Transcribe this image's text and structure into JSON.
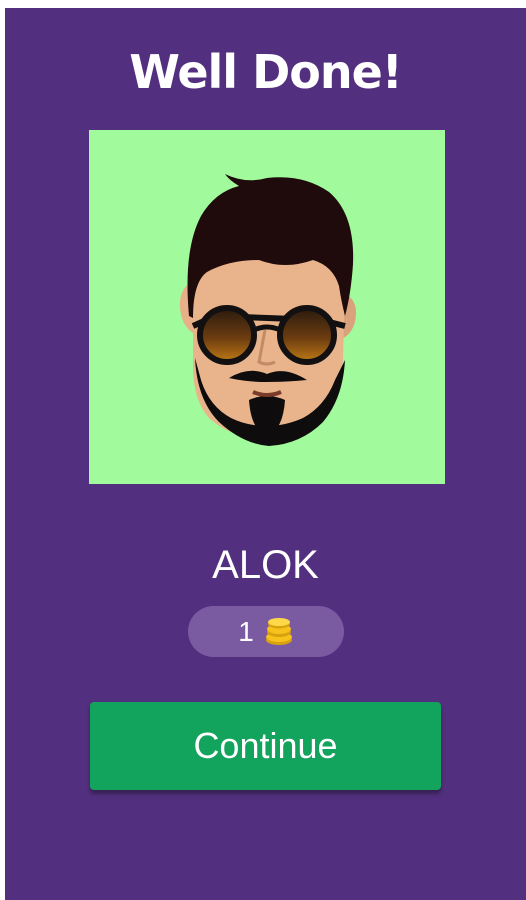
{
  "dialog": {
    "title": "Well Done!",
    "answer": "ALOK",
    "reward": {
      "count": "1",
      "icon": "coins-icon"
    },
    "continue_label": "Continue"
  },
  "colors": {
    "panel_background": "#53307f",
    "portrait_background": "#a1fb9c",
    "reward_pill": "#7a5aa1",
    "continue_button": "#12a35c",
    "coin": "#f6c21b"
  }
}
